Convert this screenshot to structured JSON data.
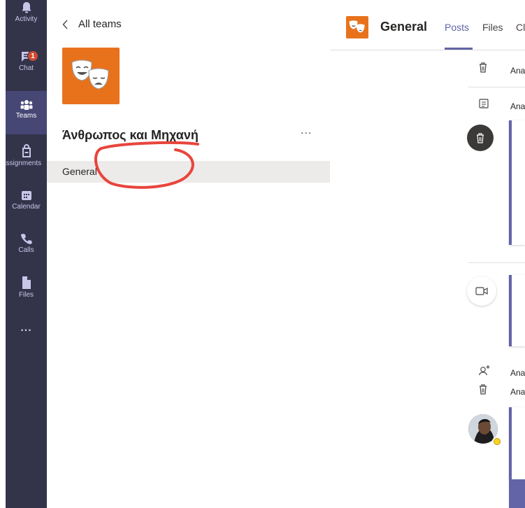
{
  "rail": {
    "items": [
      {
        "label": "Activity",
        "icon": "bell-icon"
      },
      {
        "label": "Chat",
        "icon": "chat-icon",
        "badge": "1"
      },
      {
        "label": "Teams",
        "icon": "teams-icon",
        "active": true
      },
      {
        "label": "Assignments",
        "icon": "assignments-icon"
      },
      {
        "label": "Calendar",
        "icon": "calendar-icon"
      },
      {
        "label": "Calls",
        "icon": "phone-icon"
      },
      {
        "label": "Files",
        "icon": "file-icon"
      }
    ],
    "more": "..."
  },
  "team_panel": {
    "back_label": "All teams",
    "team_name": "Άνθρωπος και Μηχανή",
    "more": "...",
    "channels": [
      {
        "label": "General"
      }
    ]
  },
  "main": {
    "channel_title": "General",
    "tabs": [
      "Posts",
      "Files",
      "Cl"
    ],
    "feed": {
      "sys_1": "Ana",
      "sys_2": "Ana",
      "sys_3": "Ana",
      "sys_4": "Ana"
    }
  },
  "colors": {
    "rail_bg": "#33344a",
    "accent": "#6264a7",
    "team_orange": "#e8721c",
    "annotation_red": "#e8453c"
  }
}
